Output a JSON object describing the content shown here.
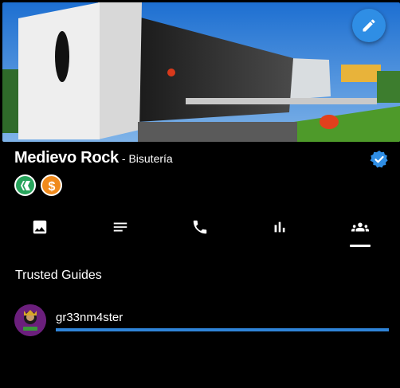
{
  "profile": {
    "name": "Medievo Rock",
    "category": "- Bisutería",
    "verified": true
  },
  "badges": [
    {
      "icon": "hive-icon",
      "color": "#27a35b"
    },
    {
      "icon": "dollar-icon",
      "color": "#f08a1c"
    }
  ],
  "tabs": [
    {
      "icon": "image-icon",
      "active": false
    },
    {
      "icon": "text-lines-icon",
      "active": false
    },
    {
      "icon": "phone-icon",
      "active": false
    },
    {
      "icon": "bar-chart-icon",
      "active": false
    },
    {
      "icon": "group-icon",
      "active": true
    }
  ],
  "section": {
    "title": "Trusted Guides"
  },
  "guides": [
    {
      "username": "gr33nm4ster",
      "progress": 1.0
    }
  ],
  "colors": {
    "accent": "#2f8ee5",
    "background": "#000000"
  }
}
